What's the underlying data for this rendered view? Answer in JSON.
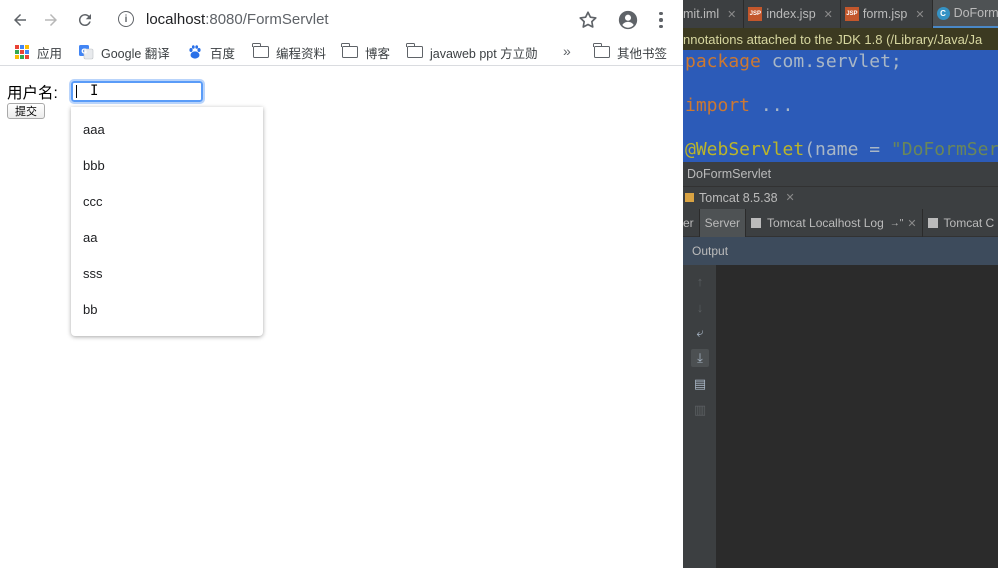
{
  "browser": {
    "url_host": "localhost",
    "url_rest": ":8080/FormServlet",
    "bookmarks": [
      {
        "label": "应用",
        "icon": "apps-icon"
      },
      {
        "label": "Google 翻译",
        "icon": "google-translate-icon"
      },
      {
        "label": "百度",
        "icon": "baidu-icon"
      },
      {
        "label": "编程资料",
        "icon": "folder-icon"
      },
      {
        "label": "博客",
        "icon": "folder-icon"
      },
      {
        "label": "javaweb ppt 方立勋",
        "icon": "folder-icon"
      }
    ],
    "more_label": "»",
    "other_bookmarks_label": "其他书签"
  },
  "form": {
    "username_label": "用户名:",
    "username_value": "",
    "submit_label": "提交",
    "autocomplete_options": [
      "aaa",
      "bbb",
      "ccc",
      "aa",
      "sss",
      "bb"
    ]
  },
  "ide": {
    "tabs": [
      {
        "label": "mit.iml",
        "icon": "iml-icon"
      },
      {
        "label": "index.jsp",
        "icon": "jsp-icon"
      },
      {
        "label": "form.jsp",
        "icon": "jsp-icon"
      },
      {
        "label": "DoForm",
        "icon": "class-icon"
      }
    ],
    "notice": "nnotations attached to the JDK 1.8 (/Library/Java/Ja",
    "code": {
      "line1_kw": "package",
      "line1_rest": " com.servlet;",
      "line2_kw": "import",
      "line2_rest": " ...",
      "line3_annotation": "@WebServlet",
      "line3_mid": "(name = ",
      "line3_str": "\"DoFormSer"
    },
    "breadcrumb": "DoFormServlet",
    "run_config": "Tomcat 8.5.38",
    "server_tabs": [
      "er",
      "Server",
      "Tomcat Localhost Log",
      "Tomcat C"
    ],
    "output_label": "Output",
    "colors": {
      "editor_bg": "#2c5bb8",
      "keyword": "#cc7832",
      "annotation": "#bbb529",
      "string": "#6a8759"
    }
  }
}
